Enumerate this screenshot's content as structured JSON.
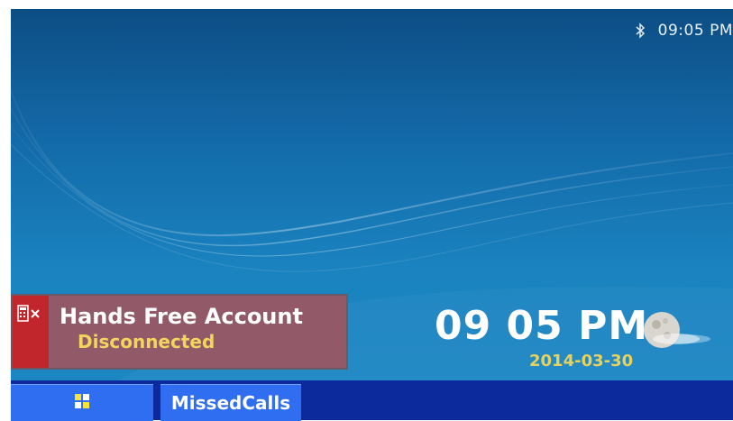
{
  "status_bar": {
    "bluetooth_icon": "bluetooth-icon",
    "time": "09:05 PM"
  },
  "account_panel": {
    "icon": "phone-disconnected-icon",
    "name": "Hands Free Account",
    "status": "Disconnected",
    "colors": {
      "icon_bg": "#c0262c",
      "panel_bg": "#925a68",
      "status_text": "#f1d55c"
    }
  },
  "clock": {
    "time": "09 05 PM",
    "date": "2014-03-30",
    "weather_icon": "moon-icon"
  },
  "taskbar": {
    "start_icon": "windows-logo-icon",
    "missed_calls_label": "MissedCalls",
    "colors": {
      "bar_bg": "#0d2a9c",
      "button_bg": "#2f6ef0"
    }
  }
}
